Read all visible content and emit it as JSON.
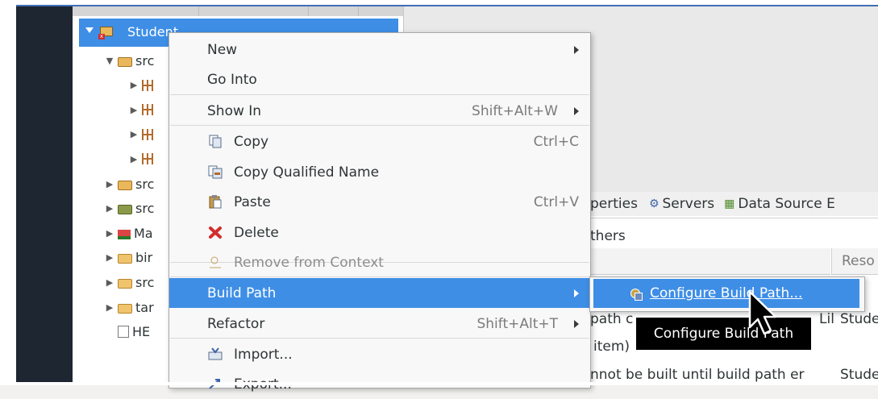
{
  "explorer": {
    "project": "Student",
    "rows": [
      {
        "label": "src",
        "icon": "source-folder-icon",
        "indent": 1,
        "expanded": true
      },
      {
        "label": "",
        "icon": "package-icon",
        "indent": 2
      },
      {
        "label": "",
        "icon": "package-icon",
        "indent": 2
      },
      {
        "label": "",
        "icon": "package-icon",
        "indent": 2
      },
      {
        "label": "",
        "icon": "package-icon",
        "indent": 2
      },
      {
        "label": "src",
        "icon": "source-folder-icon",
        "indent": 1
      },
      {
        "label": "src",
        "icon": "source-folder-green-icon",
        "indent": 1
      },
      {
        "label": "Ma",
        "icon": "maven-deps-icon",
        "indent": 1
      },
      {
        "label": "bir",
        "icon": "folder-icon",
        "indent": 1
      },
      {
        "label": "src",
        "icon": "folder-icon",
        "indent": 1
      },
      {
        "label": "tar",
        "icon": "folder-icon",
        "indent": 1
      },
      {
        "label": "HE",
        "icon": "html-file-icon",
        "indent": 1
      }
    ]
  },
  "views": {
    "tabs_text_1": "perties",
    "tab_servers": "Servers",
    "tab_datasource": "Data Source E",
    "sub_text": "thers",
    "col_reso": "Reso",
    "row1_a": "path c",
    "row1_b": "Lil",
    "row1_c": "Stude",
    "row2_a": "item)",
    "row3_a": "nnot be built until build path er",
    "row3_b": "Stude"
  },
  "menu": {
    "items": [
      {
        "label": "New",
        "accel": "",
        "submenu": true
      },
      {
        "label": "Go Into",
        "accel": "",
        "submenu": false
      },
      {
        "label": "Show In",
        "accel": "Shift+Alt+W",
        "submenu": true
      },
      {
        "label": "Copy",
        "accel": "Ctrl+C",
        "icon": "copy-icon"
      },
      {
        "label": "Copy Qualified Name",
        "accel": "",
        "icon": "copy-qualified-name-icon"
      },
      {
        "label": "Paste",
        "accel": "Ctrl+V",
        "icon": "paste-icon"
      },
      {
        "label": "Delete",
        "accel": "",
        "icon": "delete-icon"
      },
      {
        "label": "Remove from Context",
        "accel": "",
        "icon": "remove-context-icon",
        "disabled": true
      },
      {
        "label": "Build Path",
        "accel": "",
        "submenu": true,
        "highlighted": true
      },
      {
        "label": "Refactor",
        "accel": "Shift+Alt+T",
        "submenu": true
      },
      {
        "label": "Import...",
        "accel": "",
        "icon": "import-icon"
      },
      {
        "label": "Export...",
        "accel": "",
        "icon": "export-icon"
      }
    ]
  },
  "submenu": {
    "item": "Configure Build Path..."
  },
  "tooltip": {
    "text": "Configure Build Path"
  },
  "colors": {
    "selection": "#3e8ee6",
    "menu_bg": "#f8f8f8",
    "side_dark": "#1d2631",
    "delete_red": "#d32d2d"
  }
}
